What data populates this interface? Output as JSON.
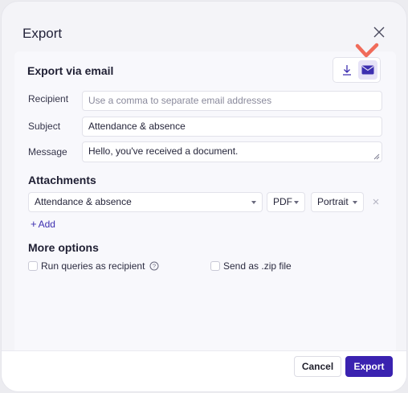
{
  "dialog": {
    "title": "Export",
    "email_section": {
      "title": "Export via email",
      "recipient_label": "Recipient",
      "recipient_placeholder": "Use a comma to separate email addresses",
      "subject_label": "Subject",
      "subject_value": "Attendance & absence",
      "message_label": "Message",
      "message_value": "Hello, you've received a document."
    },
    "attachments": {
      "title": "Attachments",
      "report": "Attendance & absence",
      "format": "PDF",
      "orientation": "Portrait",
      "add_label": "Add"
    },
    "more_options": {
      "title": "More options",
      "run_as_recipient": "Run queries as recipient",
      "send_as_zip": "Send as .zip file"
    },
    "footer": {
      "cancel": "Cancel",
      "export": "Export"
    }
  },
  "colors": {
    "accent": "#3a22b0",
    "annotation_check": "#f06b5a",
    "email_toggle_bg": "#e7e3f7"
  }
}
